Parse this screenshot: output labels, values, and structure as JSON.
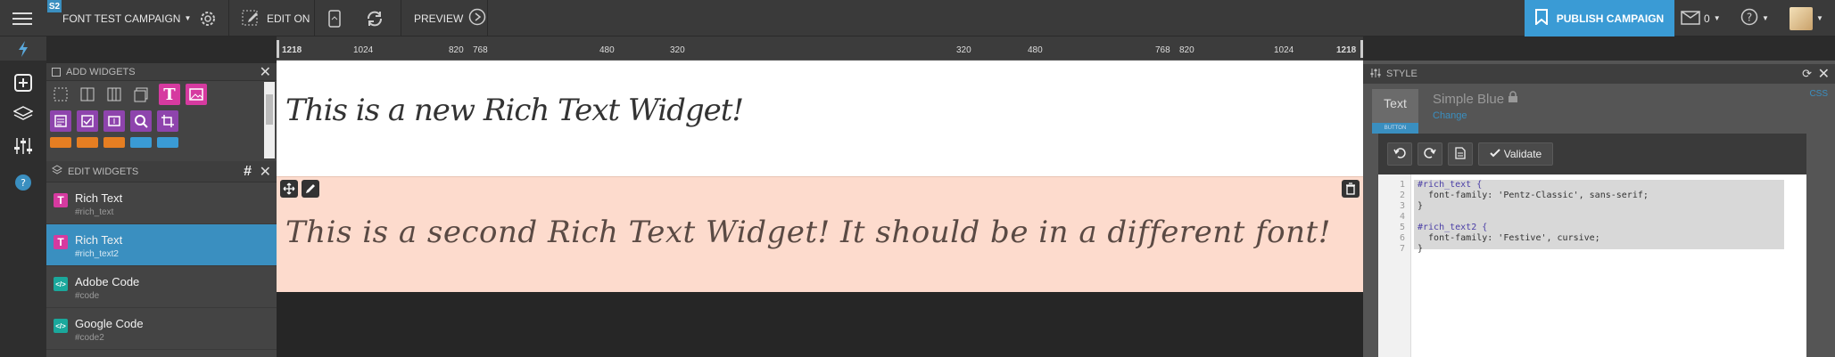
{
  "topbar": {
    "badge": "S2",
    "campaign": "FONT TEST CAMPAIGN",
    "edit_on": "EDIT ON",
    "preview": "PREVIEW",
    "publish": "PUBLISH CAMPAIGN",
    "inbox_count": "0",
    "colors": {
      "bg": "#3a3a3a",
      "publish": "#3a9bd5"
    }
  },
  "add_widgets": {
    "title": "ADD WIDGETS"
  },
  "edit_widgets": {
    "title": "EDIT WIDGETS",
    "items": [
      {
        "name": "Rich Text",
        "id": "#rich_text",
        "icon": "T"
      },
      {
        "name": "Rich Text",
        "id": "#rich_text2",
        "icon": "T"
      },
      {
        "name": "Adobe Code",
        "id": "#code",
        "icon": "</>"
      },
      {
        "name": "Google Code",
        "id": "#code2",
        "icon": "</>"
      }
    ]
  },
  "ruler": {
    "left": [
      "1218",
      "1024",
      "820",
      "768",
      "480",
      "320"
    ],
    "right": [
      "320",
      "480",
      "768",
      "820",
      "1024",
      "1218"
    ]
  },
  "canvas": {
    "widget1_text": "This is a new Rich Text Widget!",
    "widget2_text": "This is a second Rich Text Widget! It should be in a different font!"
  },
  "style": {
    "title": "STYLE",
    "tab_text": "Text",
    "tab_sub": "BUTTON",
    "theme": "Simple Blue",
    "change": "Change",
    "css_label": "CSS",
    "validate": "Validate"
  },
  "code": {
    "lines": [
      "#rich_text {",
      "  font-family: 'Pentz-Classic', sans-serif;",
      "}",
      "",
      "#rich_text2 {",
      "  font-family: 'Festive', cursive;",
      "}"
    ]
  }
}
